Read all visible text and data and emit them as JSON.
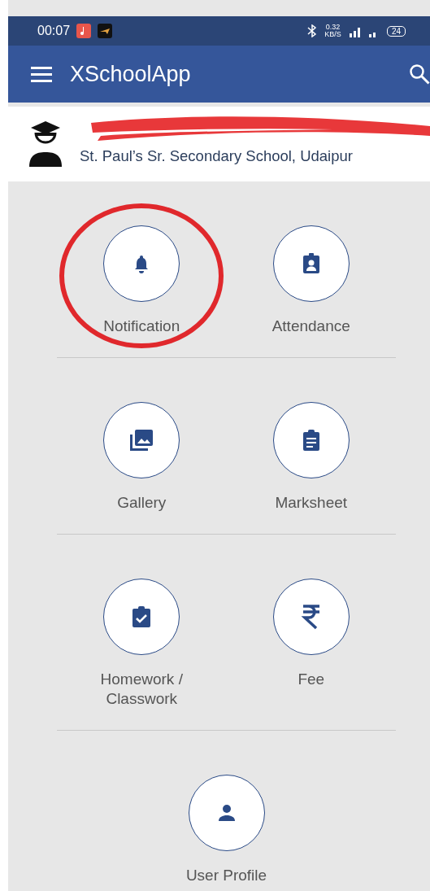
{
  "status_bar": {
    "time": "00:07",
    "speed": "0.32",
    "speed_unit": "KB/S",
    "battery": "24"
  },
  "app_bar": {
    "title": "XSchoolApp"
  },
  "profile": {
    "school": "St. Paul’s Sr. Secondary School, Udaipur",
    "name_redacted": true
  },
  "menu_rows": [
    {
      "items": [
        {
          "kind": "bell",
          "label": "Notification",
          "circled": true
        },
        {
          "kind": "badge",
          "label": "Attendance",
          "circled": false
        }
      ]
    },
    {
      "items": [
        {
          "kind": "image",
          "label": "Gallery",
          "circled": false
        },
        {
          "kind": "clipboard",
          "label": "Marksheet",
          "circled": false
        }
      ]
    },
    {
      "items": [
        {
          "kind": "check",
          "label": "Homework /\nClasswork",
          "circled": false
        },
        {
          "kind": "rupee",
          "label": "Fee",
          "circled": false
        }
      ]
    },
    {
      "items": [
        {
          "kind": "person",
          "label": "User Profile",
          "circled": false
        }
      ]
    }
  ]
}
